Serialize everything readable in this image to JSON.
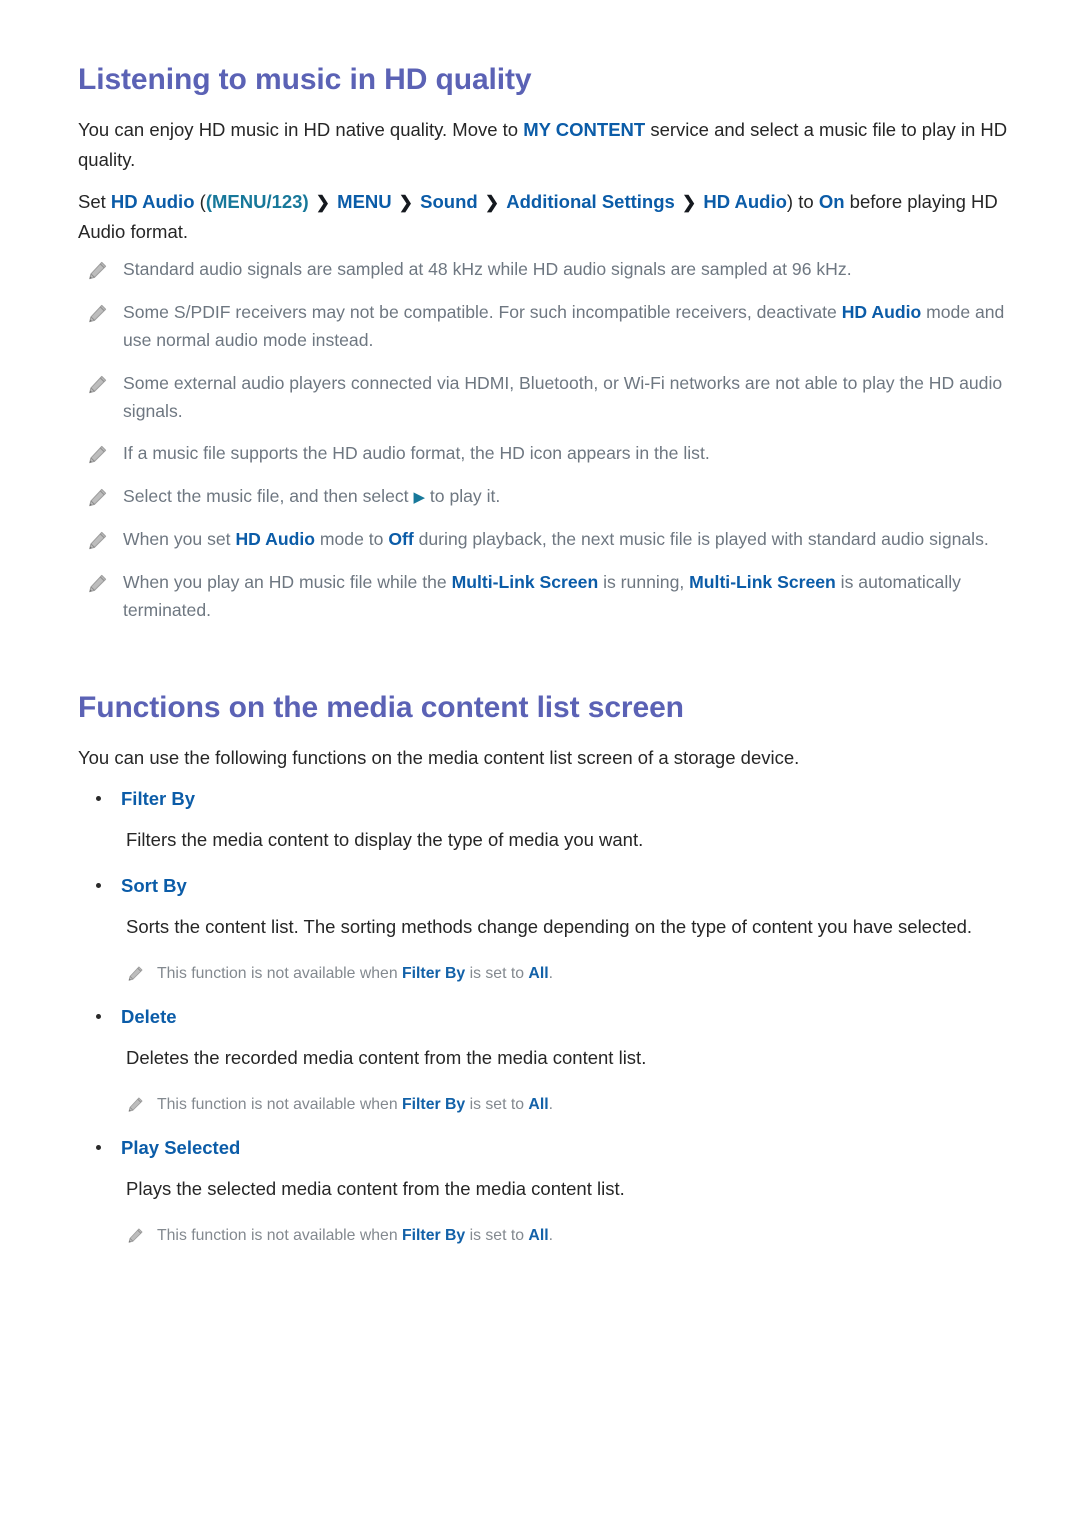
{
  "document": {
    "section1": {
      "title": "Listening to music in HD quality",
      "intro_parts": [
        {
          "text": "You can enjoy HD music in HD native quality. Move to ",
          "style": "plain"
        },
        {
          "text": "MY CONTENT",
          "style": "blue"
        },
        {
          "text": " service and select a music file to play in HD quality.",
          "style": "plain"
        }
      ],
      "intro_plain": "You can enjoy HD music in HD native quality. Move to MY CONTENT service and select a music file to play in HD quality.",
      "path_line": {
        "prefix": "Set ",
        "setting": "HD Audio",
        "open_paren": "(",
        "menu_key": "(MENU/123)",
        "crumbs": [
          "MENU",
          "Sound",
          "Additional Settings",
          "HD Audio"
        ],
        "separator": "❯",
        "close_paren": ")",
        "middle": " to ",
        "value": "On",
        "suffix": " before playing HD Audio format."
      },
      "notes": [
        {
          "icon": "pencil-icon",
          "parts": [
            {
              "text": "Standard audio signals are sampled at 48 kHz while HD audio signals are sampled at 96 kHz.",
              "style": "plain"
            }
          ]
        },
        {
          "icon": "pencil-icon",
          "parts": [
            {
              "text": "Some S/PDIF receivers may not be compatible. For such incompatible receivers, deactivate ",
              "style": "plain"
            },
            {
              "text": "HD Audio",
              "style": "blue"
            },
            {
              "text": " mode and use normal audio mode instead.",
              "style": "plain"
            }
          ]
        },
        {
          "icon": "pencil-icon",
          "parts": [
            {
              "text": "Some external audio players connected via HDMI, Bluetooth, or Wi-Fi networks are not able to play the HD audio signals.",
              "style": "plain"
            }
          ]
        },
        {
          "icon": "pencil-icon",
          "parts": [
            {
              "text": "If a music file supports the HD audio format, the HD icon appears in the list.",
              "style": "plain"
            }
          ]
        },
        {
          "icon": "pencil-icon",
          "parts": [
            {
              "text": "Select the music file, and then select ",
              "style": "plain"
            },
            {
              "text": "▶",
              "style": "play"
            },
            {
              "text": " to play it.",
              "style": "plain"
            }
          ]
        },
        {
          "icon": "pencil-icon",
          "parts": [
            {
              "text": "When you set ",
              "style": "plain"
            },
            {
              "text": "HD Audio",
              "style": "blue"
            },
            {
              "text": " mode to ",
              "style": "plain"
            },
            {
              "text": "Off",
              "style": "blue"
            },
            {
              "text": " during playback, the next music file is played with standard audio signals.",
              "style": "plain"
            }
          ]
        },
        {
          "icon": "pencil-icon",
          "parts": [
            {
              "text": "When you play an HD music file while the ",
              "style": "plain"
            },
            {
              "text": "Multi-Link Screen",
              "style": "blue"
            },
            {
              "text": " is running, ",
              "style": "plain"
            },
            {
              "text": "Multi-Link Screen",
              "style": "blue"
            },
            {
              "text": " is automatically terminated.",
              "style": "plain"
            }
          ]
        }
      ]
    },
    "section2": {
      "title": "Functions on the media content list screen",
      "intro": "You can use the following functions on the media content list screen of a storage device.",
      "items": [
        {
          "label": "Filter By",
          "description": "Filters the media content to display the type of media you want.",
          "note": null
        },
        {
          "label": "Sort By",
          "description": "Sorts the content list. The sorting methods change depending on the type of content you have selected.",
          "note": {
            "icon": "pencil-icon",
            "parts": [
              {
                "text": "This function is not available when ",
                "style": "plain"
              },
              {
                "text": "Filter By",
                "style": "blue"
              },
              {
                "text": " is set to ",
                "style": "plain"
              },
              {
                "text": "All",
                "style": "blue"
              },
              {
                "text": ".",
                "style": "plain"
              }
            ]
          }
        },
        {
          "label": "Delete",
          "description": "Deletes the recorded media content from the media content list.",
          "note": {
            "icon": "pencil-icon",
            "parts": [
              {
                "text": "This function is not available when ",
                "style": "plain"
              },
              {
                "text": "Filter By",
                "style": "blue"
              },
              {
                "text": " is set to ",
                "style": "plain"
              },
              {
                "text": "All",
                "style": "blue"
              },
              {
                "text": ".",
                "style": "plain"
              }
            ]
          }
        },
        {
          "label": "Play Selected",
          "description": "Plays the selected media content from the media content list.",
          "note": {
            "icon": "pencil-icon",
            "parts": [
              {
                "text": "This function is not available when ",
                "style": "plain"
              },
              {
                "text": "Filter By",
                "style": "blue"
              },
              {
                "text": " is set to ",
                "style": "plain"
              },
              {
                "text": "All",
                "style": "blue"
              },
              {
                "text": ".",
                "style": "plain"
              }
            ]
          }
        }
      ]
    },
    "colors": {
      "heading": "#5b62b5",
      "link_blue": "#0b5ca8",
      "teal": "#17789a",
      "body_text": "#262626",
      "note_text": "#6e7781",
      "subnote_text": "#83898f"
    }
  }
}
